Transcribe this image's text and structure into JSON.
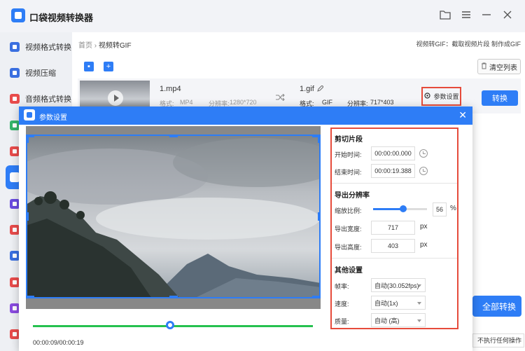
{
  "app": {
    "title": "口袋视频转换器"
  },
  "colors": {
    "accent": "#2e7df6",
    "highlight": "#e64b3b",
    "timeline": "#26c14f"
  },
  "window_buttons": [
    "folder-icon",
    "menu-icon",
    "minimize-icon",
    "close-icon"
  ],
  "sidebar": {
    "items": [
      {
        "label": "视频格式转换",
        "icon": "video-format-icon",
        "color": "#3a6fe0"
      },
      {
        "label": "视频压缩",
        "icon": "video-compress-icon",
        "color": "#3a6fe0"
      },
      {
        "label": "音频格式转换",
        "icon": "audio-format-icon",
        "color": "#e84b4b"
      },
      {
        "label": "",
        "icon": "green-tool-icon",
        "color": "#34b46a"
      },
      {
        "label": "",
        "icon": "red-tool-icon",
        "color": "#e84b4b"
      },
      {
        "label": "",
        "icon": "gif-tool-icon",
        "color": "#ffffff",
        "active": true
      },
      {
        "label": "",
        "icon": "purple-tool-icon",
        "color": "#6a4be0"
      },
      {
        "label": "",
        "icon": "red-tool-icon-2",
        "color": "#e84b4b"
      },
      {
        "label": "",
        "icon": "blue-tool-icon",
        "color": "#3a6fe0"
      },
      {
        "label": "",
        "icon": "red-tool-icon-3",
        "color": "#e84b4b"
      },
      {
        "label": "",
        "icon": "purple-tool-icon-2",
        "color": "#8a4be0"
      },
      {
        "label": "",
        "icon": "red-tool-icon-4",
        "color": "#e84b4b"
      }
    ]
  },
  "main": {
    "breadcrumb": {
      "home": "首页",
      "sep": "›",
      "current": "视频转GIF"
    },
    "top_hint": "视频转GIF：截取视频片段 制作成GIF",
    "clear_list": "清空列表",
    "file": {
      "source_name": "1.mp4",
      "source_format_label": "格式:",
      "source_format": "MP4",
      "source_res_label": "分辨率:",
      "source_res": "1280*720",
      "target_name": "1.gif",
      "target_format_label": "格式:",
      "target_format": "GIF",
      "target_res_label": "分辨率:",
      "target_res": "717*403"
    },
    "param_button": "参数设置",
    "convert_button": "转换",
    "convert_all_button": "全部转换",
    "after_op": "不执行任何操作"
  },
  "dialog": {
    "title": "参数设置",
    "time_display": "00:00:09/00:00:19",
    "timeline_progress": 0.49,
    "cut": {
      "title": "剪切片段",
      "start_label": "开始时间:",
      "start_value": "00:00:00.000",
      "end_label": "结束时间:",
      "end_value": "00:00:19.388"
    },
    "resolution": {
      "title": "导出分辨率",
      "scale_label": "缩放比例:",
      "scale_value": "56",
      "scale_unit": "%",
      "scale_fraction": 0.56,
      "width_label": "导出宽度:",
      "width_value": "717",
      "height_label": "导出高度:",
      "height_value": "403",
      "px_unit": "px"
    },
    "other": {
      "title": "其他设置",
      "fps_label": "帧率:",
      "fps_value": "自动(30.052fps)",
      "speed_label": "速度:",
      "speed_value": "自动(1x)",
      "quality_label": "质量:",
      "quality_value": "自动 (高)"
    }
  }
}
